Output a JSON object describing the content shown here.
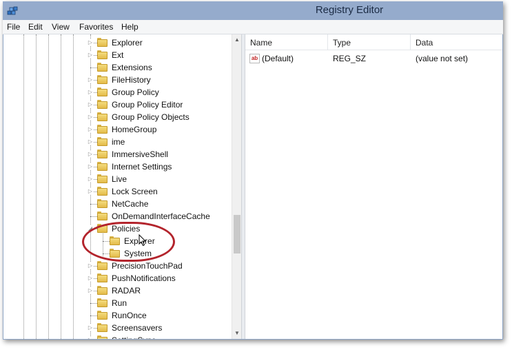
{
  "window": {
    "title": "Registry Editor",
    "app_icon": "registry-editor-icon"
  },
  "menubar": {
    "items": [
      "File",
      "Edit",
      "View",
      "Favorites",
      "Help"
    ]
  },
  "tree": {
    "items": [
      {
        "label": "Explorer",
        "expander": "▷",
        "icon": "folder-icon"
      },
      {
        "label": "Ext",
        "expander": "▷",
        "icon": "folder-icon"
      },
      {
        "label": "Extensions",
        "expander": "",
        "icon": "folder-icon"
      },
      {
        "label": "FileHistory",
        "expander": "▷",
        "icon": "folder-icon"
      },
      {
        "label": "Group Policy",
        "expander": "▷",
        "icon": "folder-icon"
      },
      {
        "label": "Group Policy Editor",
        "expander": "▷",
        "icon": "folder-icon"
      },
      {
        "label": "Group Policy Objects",
        "expander": "▷",
        "icon": "folder-icon"
      },
      {
        "label": "HomeGroup",
        "expander": "▷",
        "icon": "folder-icon"
      },
      {
        "label": "ime",
        "expander": "▷",
        "icon": "folder-icon"
      },
      {
        "label": "ImmersiveShell",
        "expander": "▷",
        "icon": "folder-icon"
      },
      {
        "label": "Internet Settings",
        "expander": "▷",
        "icon": "folder-icon"
      },
      {
        "label": "Live",
        "expander": "▷",
        "icon": "folder-icon"
      },
      {
        "label": "Lock Screen",
        "expander": "▷",
        "icon": "folder-icon"
      },
      {
        "label": "NetCache",
        "expander": "",
        "icon": "folder-icon"
      },
      {
        "label": "OnDemandInterfaceCache",
        "expander": "",
        "icon": "folder-icon"
      },
      {
        "label": "Policies",
        "expander": "◢",
        "icon": "folder-icon",
        "expanded": true
      },
      {
        "label": "Explorer",
        "expander": "",
        "icon": "folder-icon",
        "child": true
      },
      {
        "label": "System",
        "expander": "",
        "icon": "folder-icon",
        "child": true
      },
      {
        "label": "PrecisionTouchPad",
        "expander": "▷",
        "icon": "folder-icon"
      },
      {
        "label": "PushNotifications",
        "expander": "▷",
        "icon": "folder-icon"
      },
      {
        "label": "RADAR",
        "expander": "▷",
        "icon": "folder-icon"
      },
      {
        "label": "Run",
        "expander": "",
        "icon": "folder-icon"
      },
      {
        "label": "RunOnce",
        "expander": "",
        "icon": "folder-icon"
      },
      {
        "label": "Screensavers",
        "expander": "▷",
        "icon": "folder-icon"
      },
      {
        "label": "SettingSync",
        "expander": "▷",
        "icon": "folder-icon"
      }
    ]
  },
  "list": {
    "columns": [
      "Name",
      "Type",
      "Data"
    ],
    "rows": [
      {
        "name": "(Default)",
        "type": "REG_SZ",
        "data": "(value not set)",
        "icon": "string-value-icon"
      }
    ]
  },
  "annotation": {
    "highlight": "red-ellipse-around-policies",
    "color": "#b3242c"
  },
  "colors": {
    "titlebar": "#95abcc",
    "menubar": "#f5f6f7",
    "folder": "#e8c35a"
  }
}
